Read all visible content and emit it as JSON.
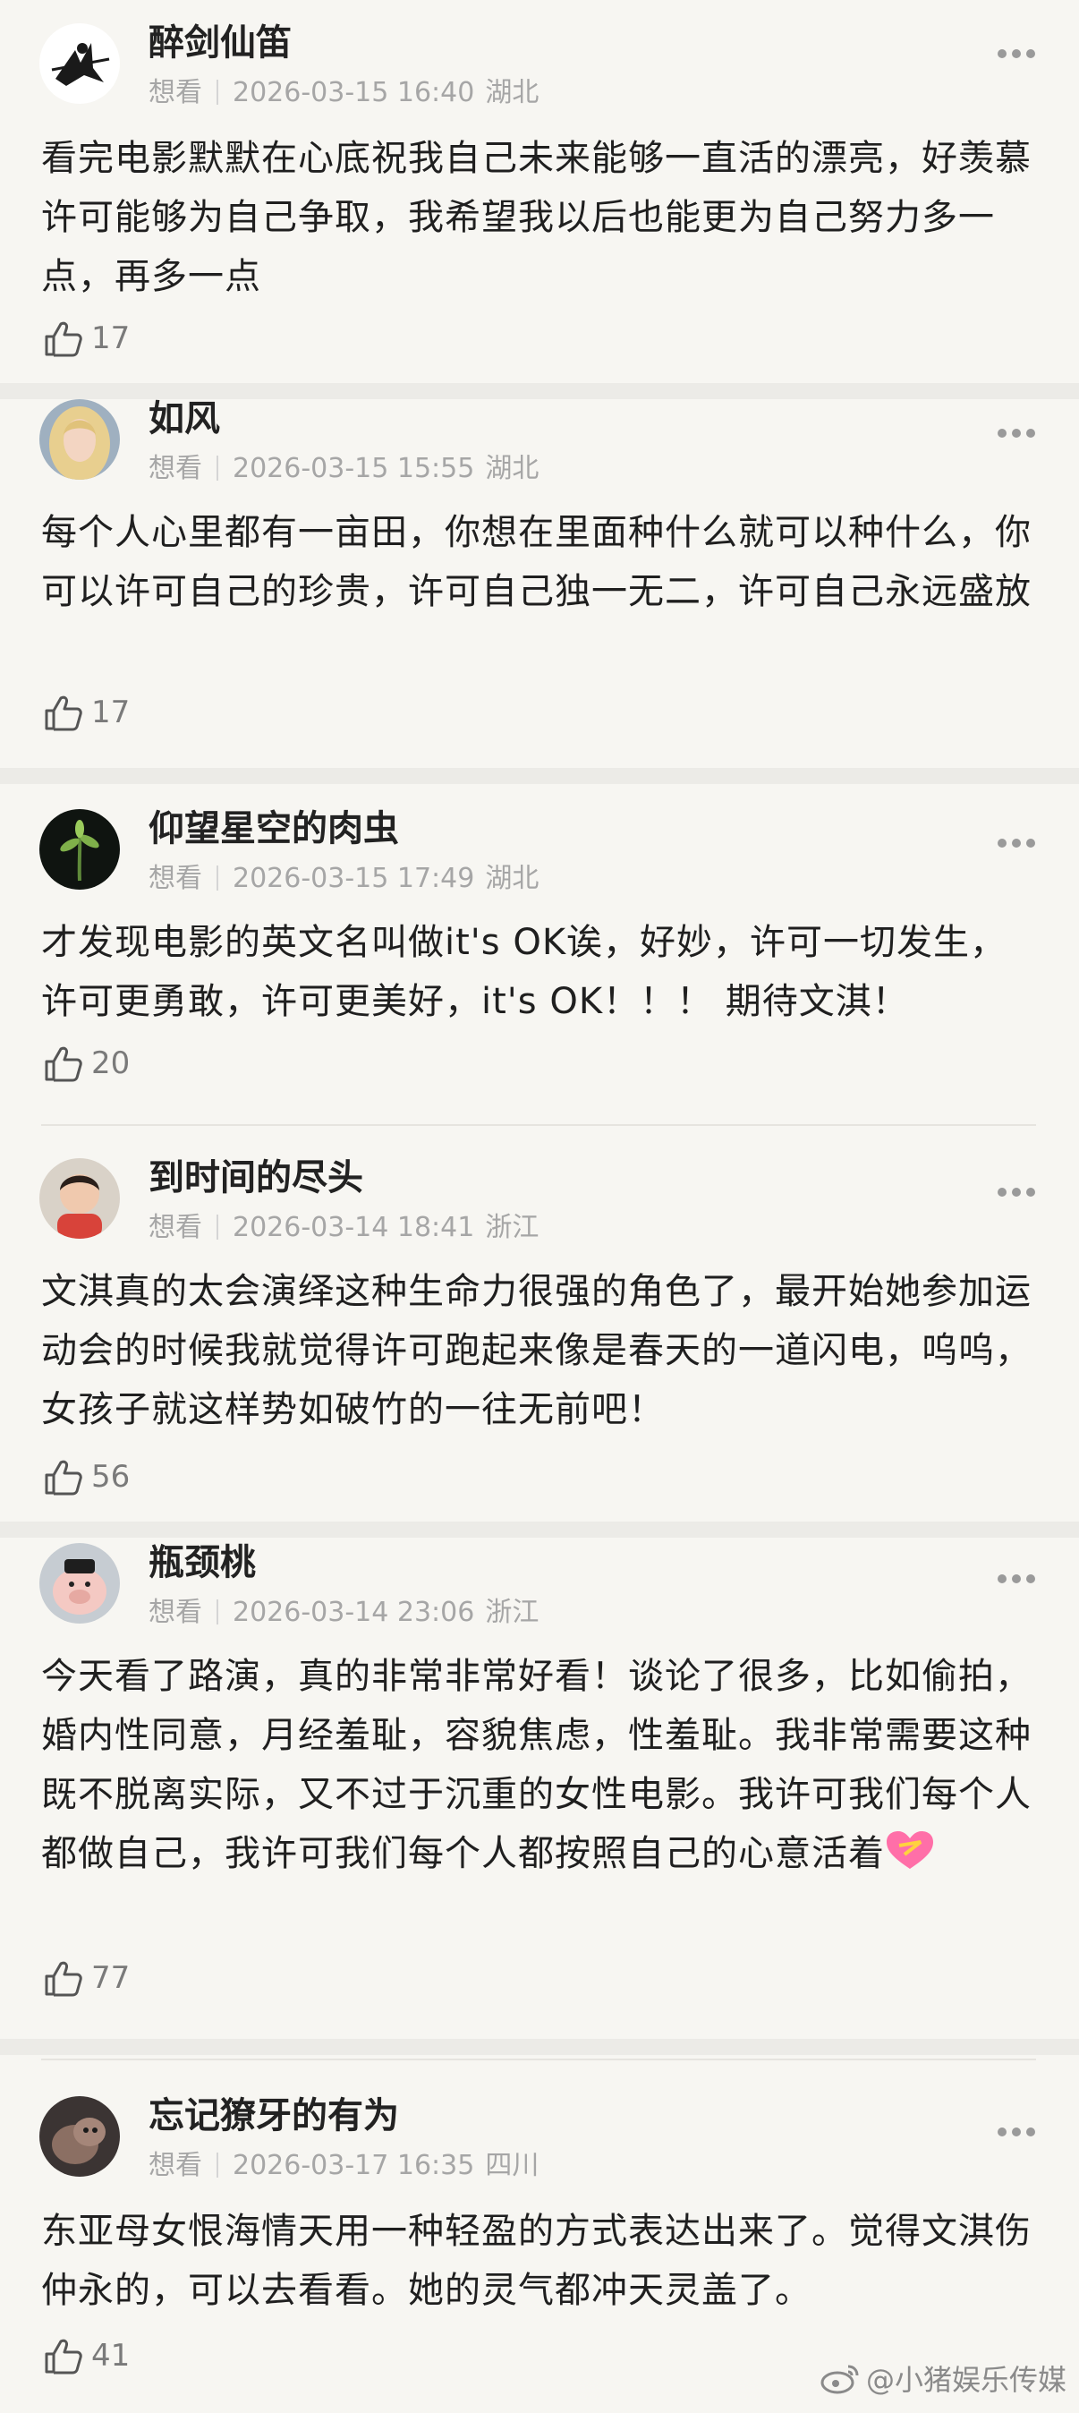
{
  "comments": [
    {
      "username": "醉剑仙笛",
      "status": "想看",
      "timestamp": "2026-03-15 16:40",
      "location": "湖北",
      "text": "看完电影默默在心底祝我自己未来能够一直活的漂亮，好羡慕许可能够为自己争取，我希望我以后也能更为自己努力多一点，再多一点",
      "likes": "17",
      "avatar_icon": "swordsman-avatar"
    },
    {
      "username": "如风",
      "status": "想看",
      "timestamp": "2026-03-15 15:55",
      "location": "湖北",
      "text": "每个人心里都有一亩田，你想在里面种什么就可以种什么，你可以许可自己的珍贵，许可自己独一无二，许可自己永远盛放",
      "likes": "17",
      "avatar_icon": "blonde-woman-avatar"
    },
    {
      "username": "仰望星空的肉虫",
      "status": "想看",
      "timestamp": "2026-03-15 17:49",
      "location": "湖北",
      "text": "才发现电影的英文名叫做it's OK诶，好妙，许可一切发生，许可更勇敢，许可更美好，it's OK！！！ 期待文淇！",
      "likes": "20",
      "avatar_icon": "plant-avatar"
    },
    {
      "username": "到时间的尽头",
      "status": "想看",
      "timestamp": "2026-03-14 18:41",
      "location": "浙江",
      "text": "文淇真的太会演绎这种生命力很强的角色了，最开始她参加运动会的时候我就觉得许可跑起来像是春天的一道闪电，呜呜，女孩子就这样势如破竹的一往无前吧！",
      "likes": "56",
      "avatar_icon": "child-avatar"
    },
    {
      "username": "瓶颈桃",
      "status": "想看",
      "timestamp": "2026-03-14 23:06",
      "location": "浙江",
      "text": "今天看了路演，真的非常非常好看！谈论了很多，比如偷拍，婚内性同意，月经羞耻，容貌焦虑，性羞耻。我非常需要这种既不脱离实际，又不过于沉重的女性电影。我许可我们每个人都做自己，我许可我们每个人都按照自己的心意活着",
      "likes": "77",
      "avatar_icon": "pig-avatar"
    },
    {
      "username": "忘记獠牙的有为",
      "status": "想看",
      "timestamp": "2026-03-17 16:35",
      "location": "四川",
      "text": "东亚母女恨海情天用一种轻盈的方式表达出来了。觉得文淇伤仲永的，可以去看看。她的灵气都冲天灵盖了。",
      "likes": "41",
      "avatar_icon": "cat-avatar"
    }
  ],
  "watermark": {
    "text": "@小猪娱乐传媒",
    "icon": "weibo-logo"
  },
  "colors": {
    "background": "#f7f6f2",
    "separator": "#ecebe7",
    "meta": "#a6a6a6",
    "like_count": "#7a7a7a"
  }
}
